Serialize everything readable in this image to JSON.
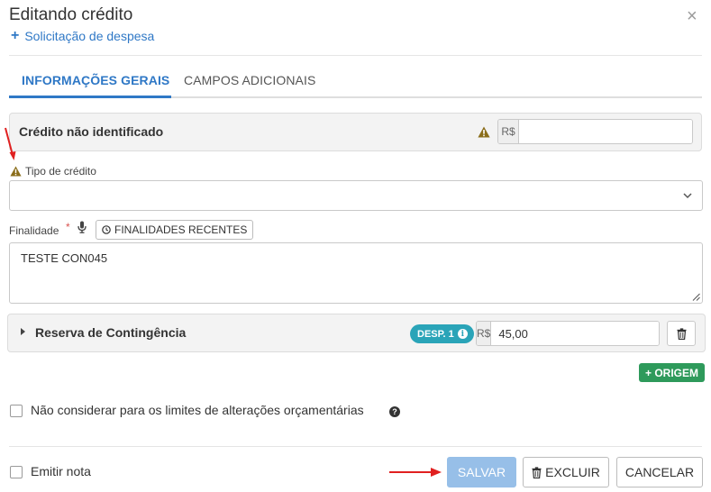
{
  "dialog": {
    "title": "Editando crédito",
    "subtitle": "Solicitação de despesa",
    "close_icon": "×"
  },
  "tabs": [
    {
      "label": "INFORMAÇÕES GERAIS",
      "active": true
    },
    {
      "label": "CAMPOS ADICIONAIS",
      "active": false
    }
  ],
  "credit_panel": {
    "label": "Crédito não identificado",
    "currency": "R$",
    "value": ""
  },
  "tipo_credito": {
    "label": "Tipo de crédito",
    "value": ""
  },
  "finalidade": {
    "label": "Finalidade",
    "required_mark": "*",
    "recent_button": "FINALIDADES RECENTES",
    "value": "TESTE CON045"
  },
  "reserva": {
    "label": "Reserva de Contingência",
    "badge": "DESP. 1",
    "currency": "R$",
    "value": "45,00"
  },
  "origem_button": "+ ORIGEM",
  "limites_checkbox": {
    "label": "Não considerar para os limites de alterações orçamentárias",
    "checked": false
  },
  "emitir_nota_checkbox": {
    "label": "Emitir nota",
    "checked": false
  },
  "footer": {
    "save": "SALVAR",
    "delete": "EXCLUIR",
    "cancel": "CANCELAR"
  },
  "colors": {
    "primary": "#2f78c6",
    "success": "#2e9a5b",
    "badge": "#2aa4b8",
    "warning": "#8a6d1a",
    "annotation": "#e02020"
  }
}
